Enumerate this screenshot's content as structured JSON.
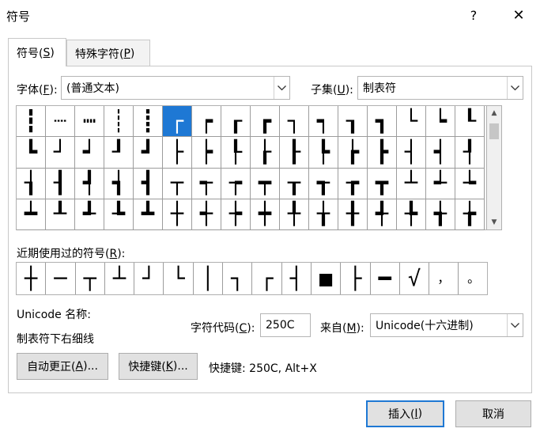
{
  "window": {
    "title": "符号",
    "help": "?",
    "close": "✕"
  },
  "tabs": [
    {
      "label_pre": "符号(",
      "key": "S",
      "label_post": ")"
    },
    {
      "label_pre": "特殊字符(",
      "key": "P",
      "label_post": ")"
    }
  ],
  "font": {
    "label_pre": "字体(",
    "key": "F",
    "label_post": "):",
    "value": "(普通文本)"
  },
  "subset": {
    "label_pre": "子集(",
    "key": "U",
    "label_post": "):",
    "value": "制表符"
  },
  "grid": {
    "rows": [
      [
        "┇",
        "┈",
        "┉",
        "┊",
        "┋",
        "┌",
        "┍",
        "┎",
        "┏",
        "┐",
        "┑",
        "┒",
        "┓",
        "└",
        "┕",
        "┖"
      ],
      [
        "┗",
        "┘",
        "┙",
        "┚",
        "┛",
        "├",
        "┝",
        "┞",
        "┟",
        "┠",
        "┡",
        "┢",
        "┣",
        "┤",
        "┥",
        "┦"
      ],
      [
        "┧",
        "┨",
        "┩",
        "┪",
        "┫",
        "┬",
        "┭",
        "┮",
        "┯",
        "┰",
        "┱",
        "┲",
        "┳",
        "┴",
        "┵",
        "┶"
      ],
      [
        "┷",
        "┸",
        "┹",
        "┺",
        "┻",
        "┼",
        "┽",
        "┾",
        "┿",
        "╀",
        "╁",
        "╂",
        "╃",
        "╄",
        "╅",
        "╆"
      ]
    ],
    "selected_row": 0,
    "selected_col": 5
  },
  "recent": {
    "label_pre": "近期使用过的符号(",
    "key": "R",
    "label_post": "):",
    "items": [
      "┼",
      "─",
      "┬",
      "┴",
      "┘",
      "└",
      "│",
      "┐",
      "┌",
      "┤",
      "■",
      "├",
      "━",
      "√",
      "，",
      "。"
    ]
  },
  "unicode_name": {
    "label": "Unicode 名称:",
    "value": "制表符下右细线"
  },
  "char_code": {
    "label_pre": "字符代码(",
    "key": "C",
    "label_post": "):",
    "value": "250C"
  },
  "from": {
    "label_pre": "来自(",
    "key": "M",
    "label_post": "):",
    "value": "Unicode(十六进制)"
  },
  "autocorrect": {
    "label_pre": "自动更正(",
    "key": "A",
    "label_post": ")..."
  },
  "shortcut_key": {
    "label_pre": "快捷键(",
    "key": "K",
    "label_post": ")..."
  },
  "shortcut_info": "快捷键: 250C, Alt+X",
  "insert": {
    "label_pre": "插入(",
    "key": "I",
    "label_post": ")"
  },
  "cancel": "取消",
  "colors": {
    "selection": "#1e78d4",
    "grid_line": "#9c9c9c"
  }
}
